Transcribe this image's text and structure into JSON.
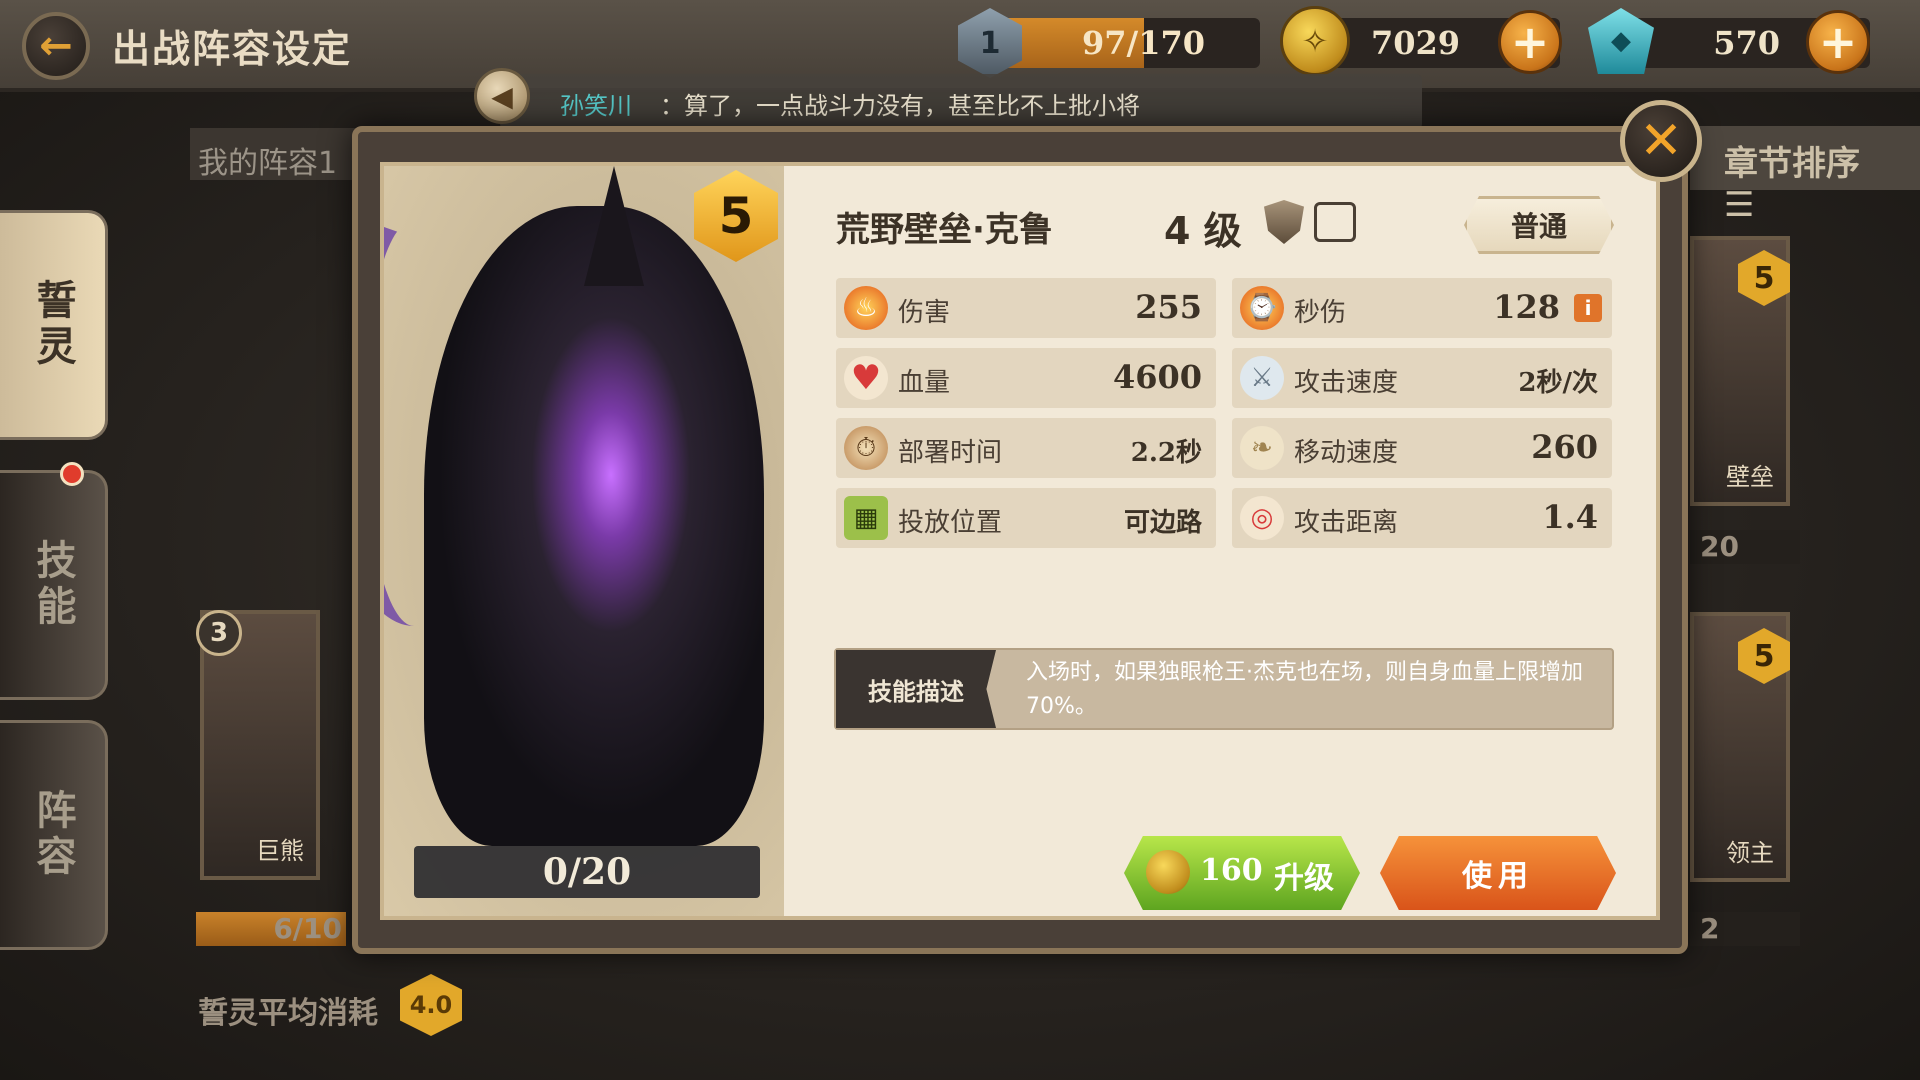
{
  "header": {
    "title": "出战阵容设定",
    "energy": {
      "badge": "1",
      "value": "97/170",
      "fraction": 0.57
    },
    "gold": {
      "value": "7029"
    },
    "gems": {
      "value": "570"
    }
  },
  "chat": {
    "name": "孙笑川",
    "message": "：算了，一点战斗力没有，甚至比不上批小将"
  },
  "background": {
    "lineup_tab": "我的阵容1",
    "chapter_sort": "章节排序 ☰",
    "sidebar": [
      {
        "label": "誓灵",
        "active": true
      },
      {
        "label": "技能",
        "active": false
      },
      {
        "label": "阵容",
        "active": false
      }
    ],
    "cards": {
      "left_bottom": {
        "level": "3",
        "name": "巨熊",
        "progress": "6/10"
      },
      "right_top": {
        "level": "5",
        "name": "壁垒",
        "progress": "20"
      },
      "right_bottom": {
        "level": "5",
        "name": "领主",
        "progress": "2"
      }
    },
    "avg_cost_label": "誓灵平均消耗",
    "avg_cost_value": "4.0"
  },
  "hero": {
    "name": "荒野壁垒·克鲁",
    "level": "4 级",
    "rank": "5",
    "rarity": "普通",
    "fragments": "0/20",
    "stats": [
      {
        "label": "伤害",
        "value": "255",
        "icon": "fire-icon"
      },
      {
        "label": "秒伤",
        "value": "128",
        "icon": "burn-clock-icon"
      },
      {
        "label": "血量",
        "value": "4600",
        "icon": "heart-icon"
      },
      {
        "label": "攻击速度",
        "value": "2秒/次",
        "icon": "sword-icon"
      },
      {
        "label": "部署时间",
        "value": "2.2秒",
        "icon": "stopwatch-icon"
      },
      {
        "label": "移动速度",
        "value": "260",
        "icon": "wing-icon"
      },
      {
        "label": "投放位置",
        "value": "可边路",
        "icon": "map-icon"
      },
      {
        "label": "攻击距离",
        "value": "1.4",
        "icon": "target-icon"
      }
    ],
    "skill_label": "技能描述",
    "skill_description": "入场时，如果独眼枪王·杰克也在场，则自身血量上限增加70%。"
  },
  "actions": {
    "upgrade_cost": "160",
    "upgrade_label": "升级",
    "use_label": "使用"
  },
  "colors": {
    "accent": "#e2a82a",
    "upgrade": "#7cc22e",
    "use": "#e86a28",
    "chat_name": "#56c8c8"
  }
}
